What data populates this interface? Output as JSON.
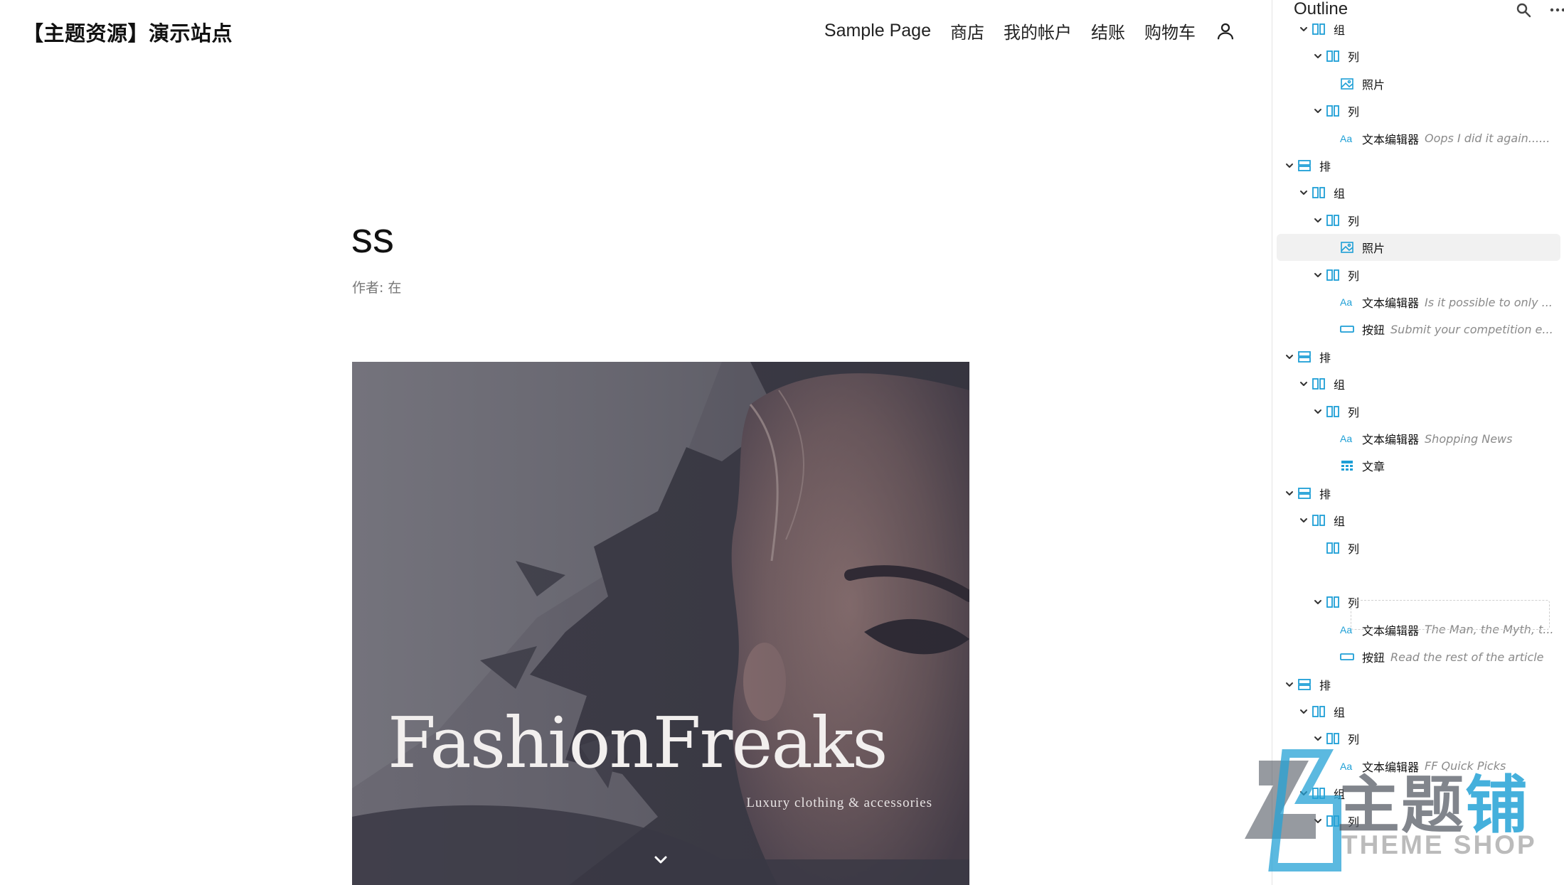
{
  "site": {
    "title": "【主题资源】演示站点"
  },
  "nav": {
    "items": [
      "Sample Page",
      "商店",
      "我的帐户",
      "结账",
      "购物车"
    ],
    "user_icon": "user-icon"
  },
  "post": {
    "title": "ss",
    "meta_author": "作者:",
    "meta_in": "在"
  },
  "hero": {
    "brand": "FashionFreaks",
    "tagline": "Luxury clothing & accessories",
    "scroll_icon": "chevron-down-icon"
  },
  "outline": {
    "title": "Outline",
    "search_icon": "search-icon",
    "more_icon": "more-dots-icon",
    "items": [
      {
        "level": 2,
        "type": "group",
        "label": "组",
        "preview": ""
      },
      {
        "level": 3,
        "type": "column",
        "label": "列",
        "preview": ""
      },
      {
        "level": 4,
        "type": "photo",
        "label": "照片",
        "preview": ""
      },
      {
        "level": 3,
        "type": "column",
        "label": "列",
        "preview": ""
      },
      {
        "level": 4,
        "type": "text",
        "label": "文本编辑器",
        "preview": "Oops I did it again......"
      },
      {
        "level": 1,
        "type": "row",
        "label": "排",
        "preview": ""
      },
      {
        "level": 2,
        "type": "group",
        "label": "组",
        "preview": ""
      },
      {
        "level": 3,
        "type": "column",
        "label": "列",
        "preview": ""
      },
      {
        "level": 4,
        "type": "photo",
        "label": "照片",
        "preview": "",
        "selected": true
      },
      {
        "level": 3,
        "type": "column",
        "label": "列",
        "preview": ""
      },
      {
        "level": 4,
        "type": "text",
        "label": "文本编辑器",
        "preview": "Is it possible to only ..."
      },
      {
        "level": 4,
        "type": "button",
        "label": "按鈕",
        "preview": "Submit your competition e..."
      },
      {
        "level": 1,
        "type": "row",
        "label": "排",
        "preview": ""
      },
      {
        "level": 2,
        "type": "group",
        "label": "组",
        "preview": ""
      },
      {
        "level": 3,
        "type": "column",
        "label": "列",
        "preview": ""
      },
      {
        "level": 4,
        "type": "text",
        "label": "文本编辑器",
        "preview": "Shopping News"
      },
      {
        "level": 4,
        "type": "posts",
        "label": "文章",
        "preview": ""
      },
      {
        "level": 1,
        "type": "row",
        "label": "排",
        "preview": ""
      },
      {
        "level": 2,
        "type": "group",
        "label": "组",
        "preview": ""
      },
      {
        "level": 3,
        "type": "column",
        "label": "列",
        "preview": "",
        "nochev": true
      },
      {
        "level": 0,
        "type": "placeholder",
        "label": "",
        "preview": ""
      },
      {
        "level": 3,
        "type": "column",
        "label": "列",
        "preview": ""
      },
      {
        "level": 4,
        "type": "text",
        "label": "文本编辑器",
        "preview": "The Man, the Myth, t..."
      },
      {
        "level": 4,
        "type": "button",
        "label": "按鈕",
        "preview": "Read the rest of the article"
      },
      {
        "level": 1,
        "type": "row",
        "label": "排",
        "preview": ""
      },
      {
        "level": 2,
        "type": "group",
        "label": "组",
        "preview": ""
      },
      {
        "level": 3,
        "type": "column",
        "label": "列",
        "preview": ""
      },
      {
        "level": 4,
        "type": "text",
        "label": "文本编辑器",
        "preview": "FF Quick Picks"
      },
      {
        "level": 2,
        "type": "group",
        "label": "组",
        "preview": ""
      },
      {
        "level": 3,
        "type": "column",
        "label": "列",
        "preview": ""
      }
    ]
  },
  "watermark": {
    "cn_gray": "主题",
    "cn_blue": "铺",
    "en": "THEME SHOP"
  },
  "colors": {
    "accent": "#1e9fd6",
    "text": "#111111",
    "muted": "#8a8a8a"
  }
}
